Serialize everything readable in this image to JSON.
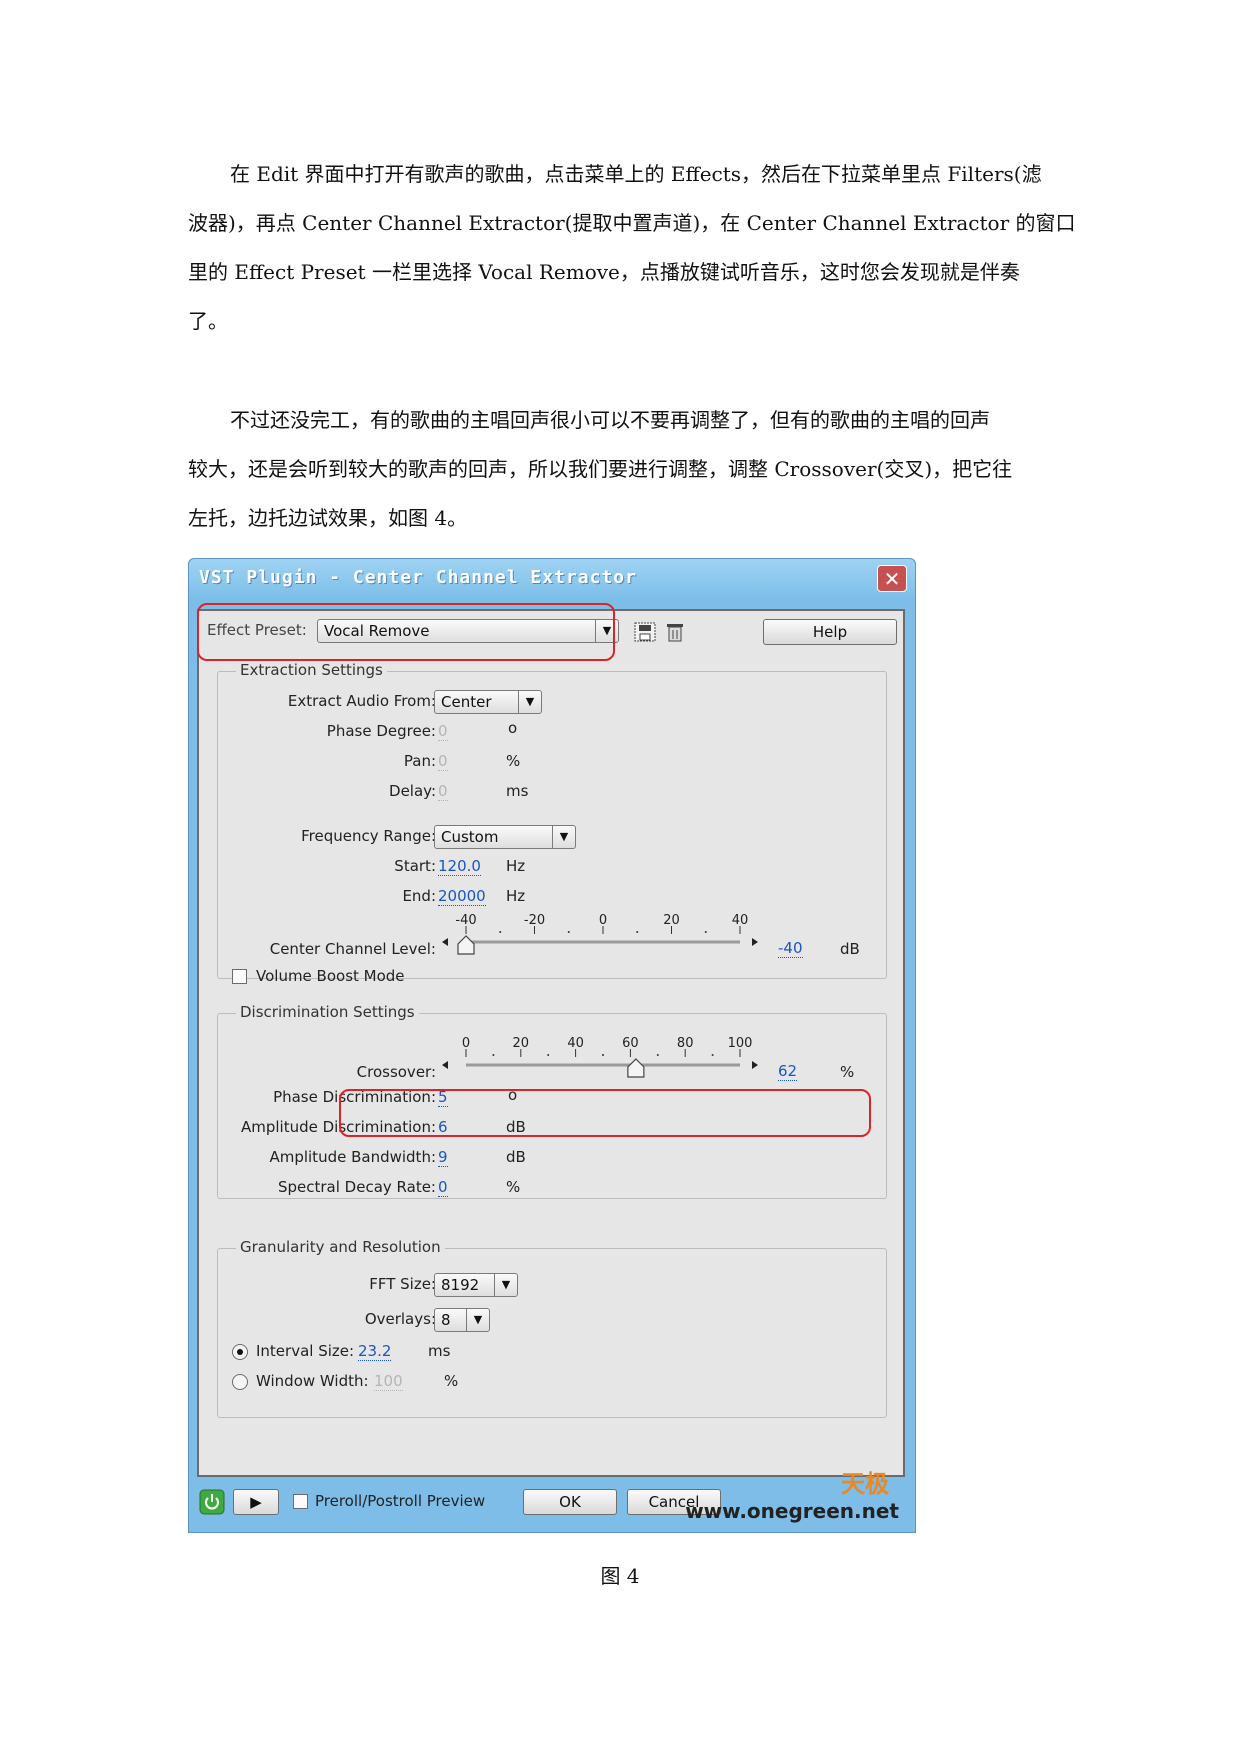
{
  "paragraphs": [
    {
      "lines": [
        "在 Edit 界面中打开有歌声的歌曲，点击菜单上的 Effects，然后在下拉菜单里点 Filters(滤",
        "波器)，再点 Center Channel Extractor(提取中置声道)，在 Center Channel Extractor 的窗口",
        "里的 Effect Preset 一栏里选择 Vocal Remove，点播放键试听音乐，这时您会发现就是伴奏",
        "了。"
      ]
    },
    {
      "lines": [
        "不过还没完工，有的歌曲的主唱回声很小可以不要再调整了，但有的歌曲的主唱的回声",
        "较大，还是会听到较大的歌声的回声，所以我们要进行调整，调整 Crossover(交叉)，把它往",
        "左托，边托边试效果，如图 4。"
      ]
    }
  ],
  "caption": "图 4",
  "dialog": {
    "title": "VST Plugin - Center Channel Extractor",
    "close_label": "✕",
    "preset_label": "Effect Preset:",
    "preset_value": "Vocal Remove",
    "help_label": "Help",
    "extraction": {
      "title": "Extraction Settings",
      "extract_from_label": "Extract Audio From:",
      "extract_from_value": "Center",
      "phase_degree_label": "Phase Degree:",
      "phase_degree_value": "0",
      "phase_degree_unit": "o",
      "pan_label": "Pan:",
      "pan_value": "0",
      "pan_unit": "%",
      "delay_label": "Delay:",
      "delay_value": "0",
      "delay_unit": "ms",
      "freq_range_label": "Frequency Range:",
      "freq_range_value": "Custom",
      "start_label": "Start:",
      "start_value": "120.0",
      "start_unit": "Hz",
      "end_label": "End:",
      "end_value": "20000",
      "end_unit": "Hz",
      "center_level_label": "Center Channel Level:",
      "center_level_value": "-40",
      "center_level_unit": "dB",
      "center_level_ticks": [
        "-40",
        "-20",
        "0",
        "20",
        "40"
      ],
      "volume_boost_label": "Volume Boost Mode"
    },
    "discrimination": {
      "title": "Discrimination Settings",
      "crossover_label": "Crossover:",
      "crossover_value": "62",
      "crossover_unit": "%",
      "crossover_ticks": [
        "0",
        "20",
        "40",
        "60",
        "80",
        "100"
      ],
      "phase_disc_label": "Phase Discrimination:",
      "phase_disc_value": "5",
      "phase_disc_unit": "o",
      "amp_disc_label": "Amplitude Discrimination:",
      "amp_disc_value": "6",
      "amp_disc_unit": "dB",
      "amp_bw_label": "Amplitude Bandwidth:",
      "amp_bw_value": "9",
      "amp_bw_unit": "dB",
      "spectral_label": "Spectral Decay Rate:",
      "spectral_value": "0",
      "spectral_unit": "%"
    },
    "granularity": {
      "title": "Granularity and Resolution",
      "fft_label": "FFT Size:",
      "fft_value": "8192",
      "overlays_label": "Overlays:",
      "overlays_value": "8",
      "interval_label": "Interval Size:",
      "interval_value": "23.2",
      "interval_unit": "ms",
      "window_label": "Window Width:",
      "window_value": "100",
      "window_unit": "%"
    },
    "bottom": {
      "preview_label": "Preroll/Postroll Preview",
      "ok_label": "OK",
      "cancel_label": "Cancel"
    },
    "watermark_logo": "天极",
    "watermark_url": "www.onegreen.net"
  }
}
